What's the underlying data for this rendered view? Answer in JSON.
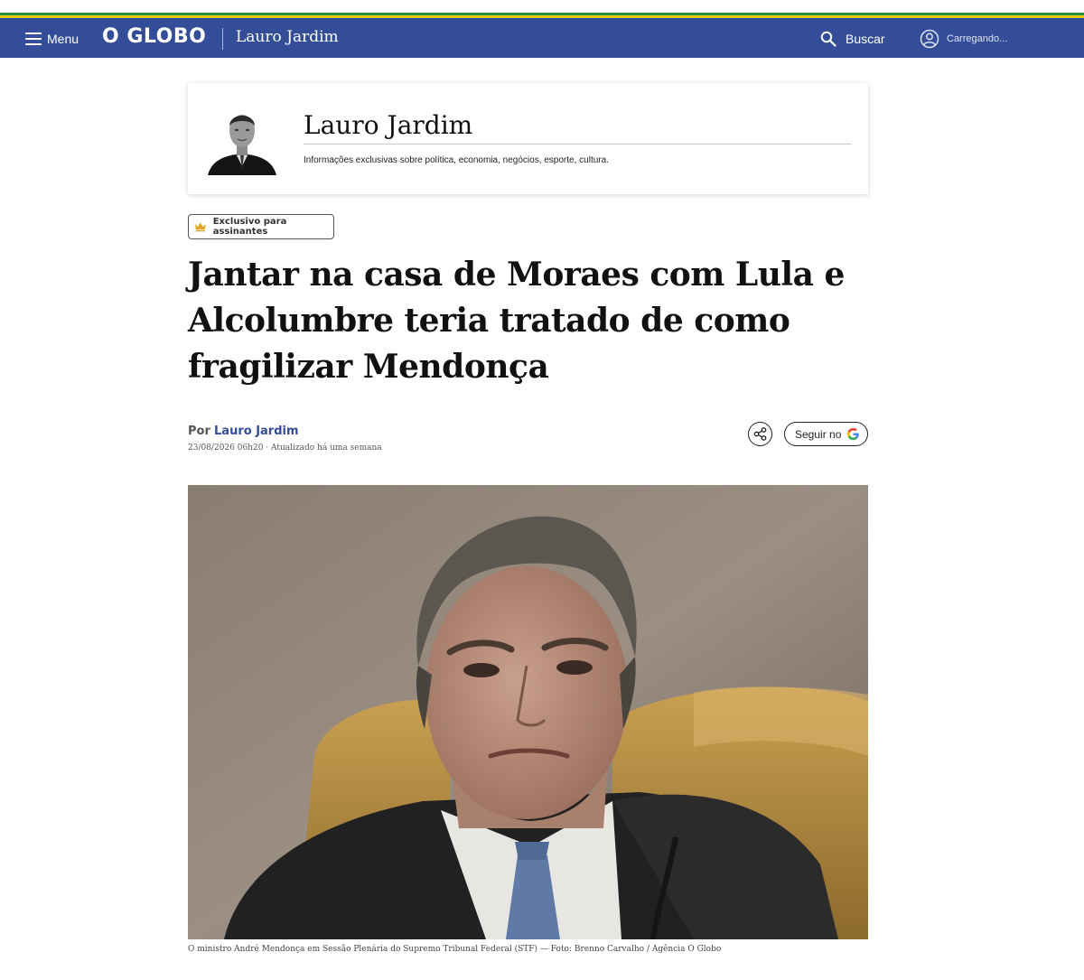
{
  "header": {
    "menu_label": "Menu",
    "logo": "O GLOBO",
    "section_title": "Lauro Jardim",
    "search_label": "Buscar",
    "user_status": "Carregando...",
    "bar_color": "#344d98"
  },
  "author_card": {
    "name": "Lauro Jardim",
    "description": "Informações exclusivas sobre política, economia, negócios, esporte, cultura."
  },
  "badge": {
    "label": "Exclusivo para assinantes",
    "icon": "crown-icon",
    "icon_color": "#e3a62a"
  },
  "article": {
    "headline": "Jantar na casa de Moraes com Lula e Alcolumbre teria tratado de como fragilizar Mendonça",
    "byline_prefix": "Por",
    "author": "Lauro Jardim",
    "dateline": "23/08/2026 06h20 · Atualizado há uma semana",
    "follow_label": "Seguir no",
    "caption": "O ministro André Mendonça em Sessão Plenária do Supremo Tribunal Federal (STF) — Foto: Brenno Carvalho / Agência O Globo"
  }
}
